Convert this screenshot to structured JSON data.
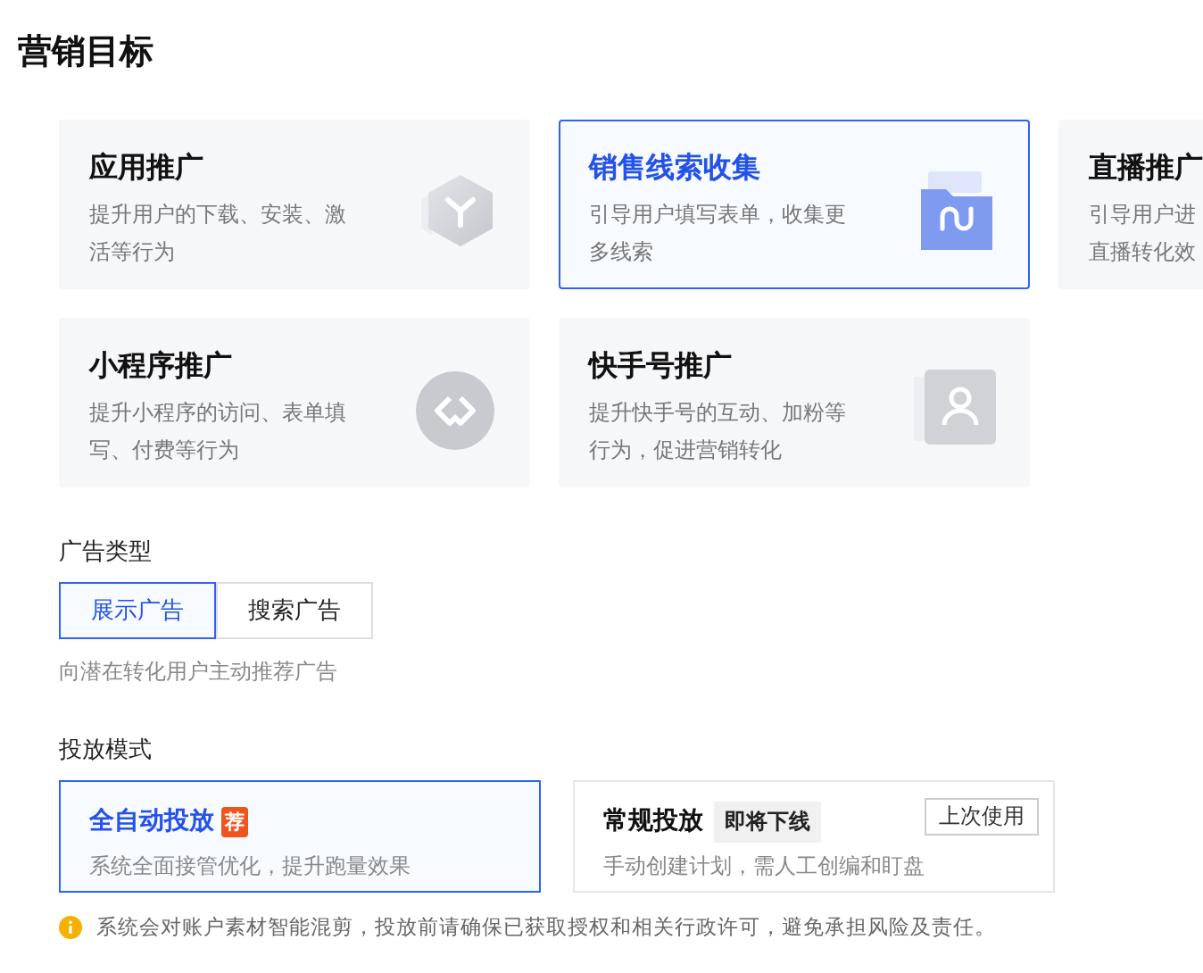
{
  "title": "营销目标",
  "goals": [
    {
      "title": "应用推广",
      "lines": [
        "提升用户的下载、安装、激",
        "活等行为"
      ],
      "selected": false
    },
    {
      "title": "销售线索收集",
      "lines": [
        "引导用户填写表单，收集更",
        "多线索"
      ],
      "selected": true
    },
    {
      "title": "直播推广",
      "lines": [
        "引导用户进",
        "直播转化效"
      ],
      "selected": false
    },
    {
      "title": "小程序推广",
      "lines": [
        "提升小程序的访问、表单填",
        "写、付费等行为"
      ],
      "selected": false
    },
    {
      "title": "快手号推广",
      "lines": [
        "提升快手号的互动、加粉等",
        "行为，促进营销转化"
      ],
      "selected": false
    }
  ],
  "ad_type": {
    "label": "广告类型",
    "options": [
      {
        "label": "展示广告",
        "selected": true
      },
      {
        "label": "搜索广告",
        "selected": false
      }
    ],
    "hint": "向潜在转化用户主动推荐广告"
  },
  "mode": {
    "label": "投放模式",
    "options": [
      {
        "title": "全自动投放",
        "badge": "荐",
        "description": "系统全面接管优化，提升跑量效果",
        "selected": true
      },
      {
        "title": "常规投放",
        "tag": "即将下线",
        "action": "上次使用",
        "description": "手动创建计划，需人工创编和盯盘",
        "selected": false
      }
    ]
  },
  "notice": "系统会对账户素材智能混剪，投放前请确保已获取授权和相关行政许可，避免承担风险及责任。"
}
